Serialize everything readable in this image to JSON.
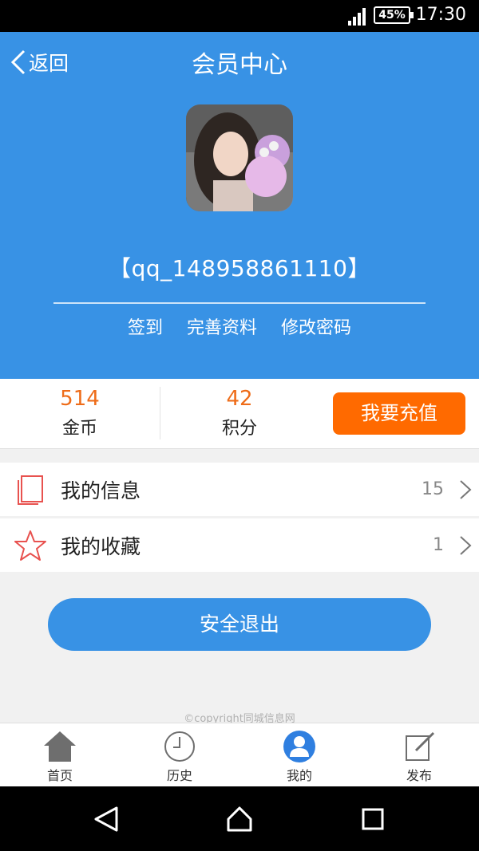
{
  "status_bar": {
    "battery": "45%",
    "time": "17:30"
  },
  "header": {
    "back_label": "返回",
    "title": "会员中心",
    "username": "【qq_148958861110】",
    "links": [
      "签到",
      "完善资料",
      "修改密码"
    ]
  },
  "stats": {
    "coins": {
      "value": "514",
      "label": "金币"
    },
    "points": {
      "value": "42",
      "label": "积分"
    },
    "recharge_label": "我要充值"
  },
  "list": [
    {
      "label": "我的信息",
      "count": "15",
      "icon": "document-icon"
    },
    {
      "label": "我的收藏",
      "count": "1",
      "icon": "star-icon"
    }
  ],
  "logout_label": "安全退出",
  "copyright": "©copyright同城信息网",
  "tabs": [
    {
      "label": "首页",
      "icon": "home-icon"
    },
    {
      "label": "历史",
      "icon": "clock-icon"
    },
    {
      "label": "我的",
      "icon": "user-icon",
      "active": true
    },
    {
      "label": "发布",
      "icon": "edit-icon"
    }
  ],
  "colors": {
    "primary": "#3892e5",
    "accent": "#ff6a00",
    "stat_value": "#ee6c19",
    "icon_red": "#e8524f"
  }
}
